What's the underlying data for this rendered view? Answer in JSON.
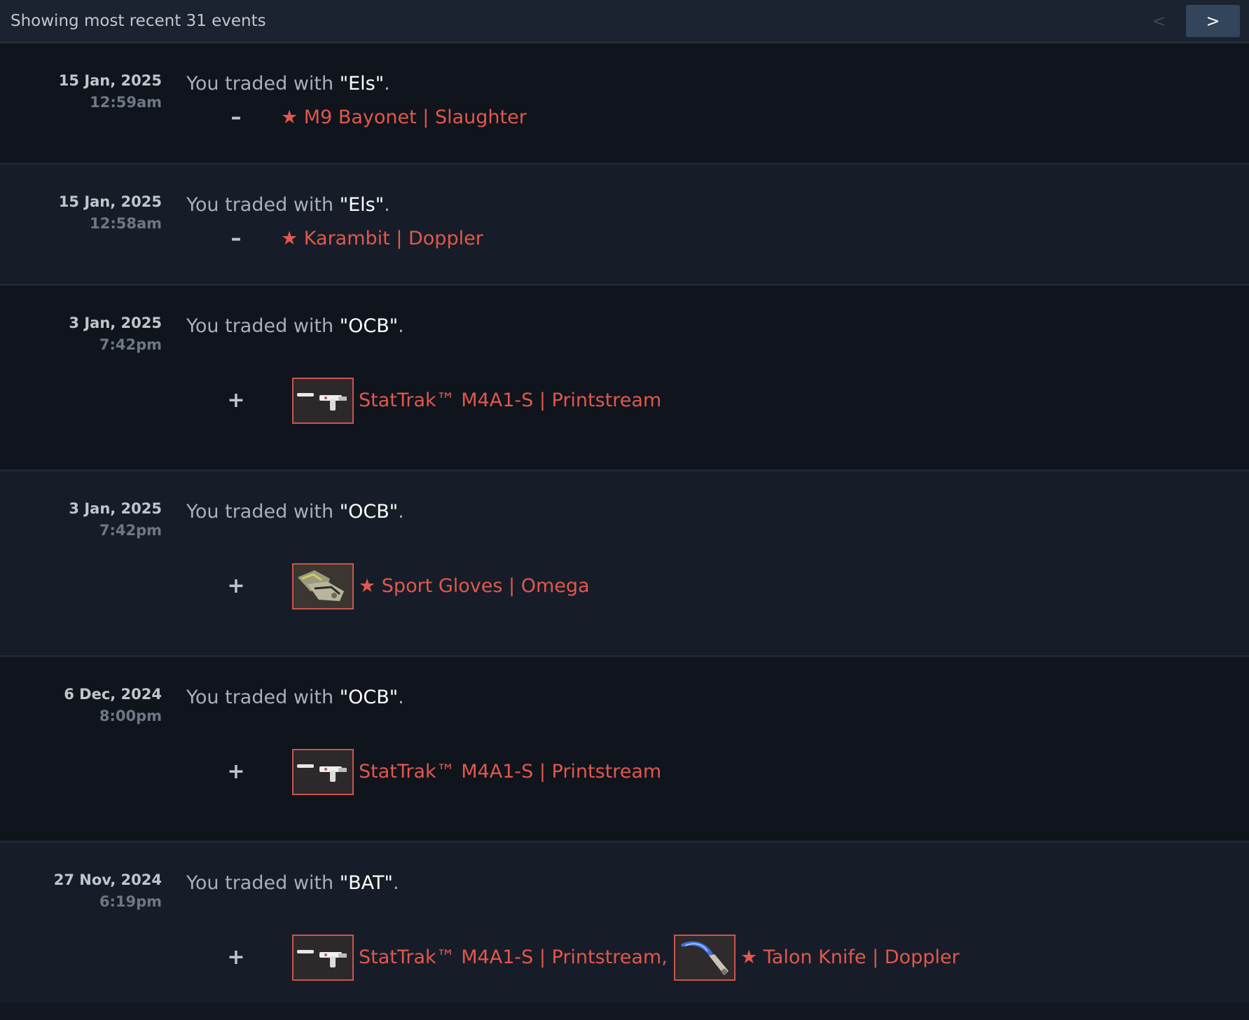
{
  "header": {
    "count_text": "Showing most recent 31 events",
    "prev_label": "<",
    "next_label": ">"
  },
  "events": [
    {
      "date": "15 Jan, 2025",
      "time": "12:59am",
      "prefix": "You traded with ",
      "partner": "\"Els\"",
      "suffix": ".",
      "sign": "–",
      "items": [
        "★ M9 Bayonet | Slaughter"
      ]
    },
    {
      "date": "15 Jan, 2025",
      "time": "12:58am",
      "prefix": "You traded with ",
      "partner": "\"Els\"",
      "suffix": ".",
      "sign": "–",
      "items": [
        "★ Karambit | Doppler"
      ]
    },
    {
      "date": "3 Jan, 2025",
      "time": "7:42pm",
      "prefix": "You traded with ",
      "partner": "\"OCB\"",
      "suffix": ".",
      "sign": "+",
      "items": [
        "StatTrak™ M4A1-S | Printstream"
      ]
    },
    {
      "date": "3 Jan, 2025",
      "time": "7:42pm",
      "prefix": "You traded with ",
      "partner": "\"OCB\"",
      "suffix": ".",
      "sign": "+",
      "items": [
        "★ Sport Gloves | Omega"
      ]
    },
    {
      "date": "6 Dec, 2024",
      "time": "8:00pm",
      "prefix": "You traded with ",
      "partner": "\"OCB\"",
      "suffix": ".",
      "sign": "+",
      "items": [
        "StatTrak™ M4A1-S | Printstream"
      ]
    },
    {
      "date": "27 Nov, 2024",
      "time": "6:19pm",
      "prefix": "You traded with ",
      "partner": "\"BAT\"",
      "suffix": ".",
      "sign": "+",
      "items": [
        "StatTrak™ M4A1-S | Printstream,",
        "★ Talon Knife | Doppler"
      ]
    }
  ],
  "icons": {
    "rifle": "rifle-icon",
    "gloves": "gloves-icon",
    "knife": "knife-icon"
  },
  "colors": {
    "item_name": "#e0584e",
    "partner": "#ffffff",
    "summary": "#a9afb9",
    "background": "#121720"
  }
}
